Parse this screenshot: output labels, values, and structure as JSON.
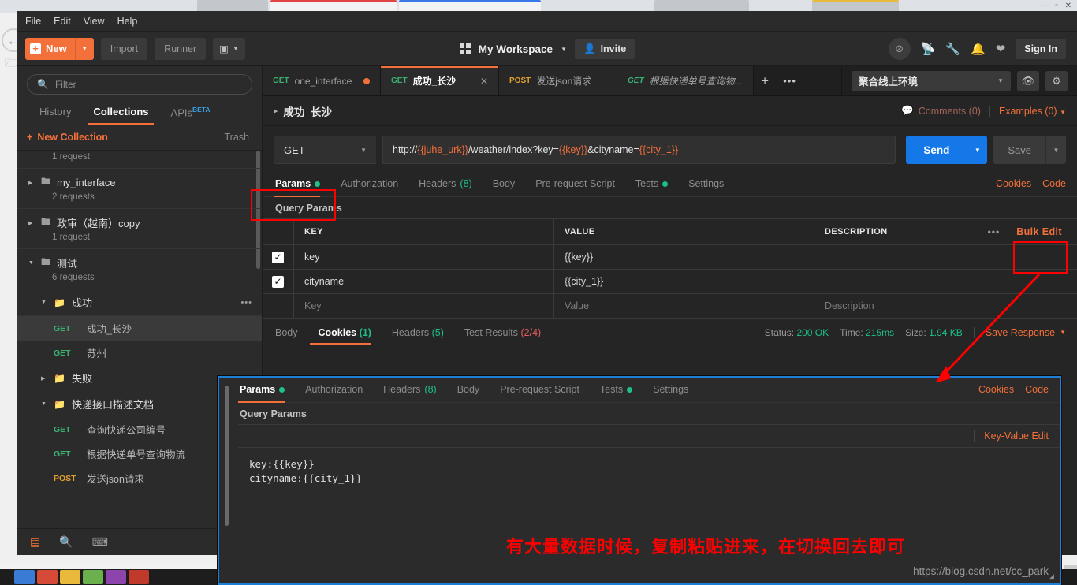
{
  "menubar": {
    "items": [
      "File",
      "Edit",
      "View",
      "Help"
    ]
  },
  "toolbar": {
    "new_label": "New",
    "import_label": "Import",
    "runner_label": "Runner",
    "workspace_name": "My Workspace",
    "invite_label": "Invite",
    "signin_label": "Sign In",
    "icons": [
      "eye-off-icon",
      "satellite-icon",
      "wrench-icon",
      "bell-icon",
      "heart-icon"
    ]
  },
  "sidebar": {
    "filter_placeholder": "Filter",
    "tabs": [
      {
        "label": "History",
        "active": false
      },
      {
        "label": "Collections",
        "active": true
      },
      {
        "label": "APIs",
        "badge": "BETA",
        "active": false
      }
    ],
    "new_collection_label": "New Collection",
    "trash_label": "Trash",
    "partial_top_request_count": "1 request",
    "collections": [
      {
        "name": "my_interface",
        "count": "2 requests",
        "expanded": false
      },
      {
        "name": "政审（越南）copy",
        "count": "1 request",
        "expanded": false
      },
      {
        "name": "测试",
        "count": "6 requests",
        "expanded": true
      }
    ],
    "folders": [
      {
        "name": "成功",
        "expanded": true,
        "requests": [
          {
            "method": "GET",
            "name": "成功_长沙",
            "selected": true
          },
          {
            "method": "GET",
            "name": "苏州",
            "selected": false
          }
        ]
      },
      {
        "name": "失败",
        "expanded": false,
        "requests": []
      },
      {
        "name": "快递接口描述文档",
        "expanded": true,
        "requests": [
          {
            "method": "GET",
            "name": "查询快递公司编号",
            "selected": false
          },
          {
            "method": "GET",
            "name": "根据快递单号查询物流",
            "selected": false
          },
          {
            "method": "POST",
            "name": "发送json请求",
            "selected": false
          }
        ]
      }
    ],
    "footer_icons": [
      "sidebar-toggle-icon",
      "search-icon",
      "console-icon"
    ]
  },
  "request_tabs": [
    {
      "method": "GET",
      "name": "one_interface",
      "state": "unsaved",
      "active": false,
      "italic": false
    },
    {
      "method": "GET",
      "name": "成功_长沙",
      "state": "close",
      "active": true,
      "italic": false
    },
    {
      "method": "POST",
      "name": "发送json请求",
      "state": "none",
      "active": false,
      "italic": false
    },
    {
      "method": "GET",
      "name": "根据快递单号查询物...",
      "state": "none",
      "active": false,
      "italic": true
    }
  ],
  "tabbar_actions": {
    "add": "+",
    "more": "•••"
  },
  "environment": {
    "selected": "聚合线上环境",
    "eye_icon": "eye-icon",
    "gear_icon": "gear-icon"
  },
  "request": {
    "title": "成功_长沙",
    "comments_label": "Comments (0)",
    "examples_label": "Examples (0)",
    "method": "GET",
    "url_prefix": "http://",
    "url_var1": "{{juhe_urk}}",
    "url_mid": "/weather/index?key=",
    "url_var2": "{{key}}",
    "url_mid2": "&cityname=",
    "url_var3": "{{city_1}}",
    "url_full": "http://{{juhe_urk}}/weather/index?key={{key}}&cityname={{city_1}}",
    "send_label": "Send",
    "save_label": "Save"
  },
  "req_tabs": [
    {
      "label": "Params",
      "dot": true,
      "active": true
    },
    {
      "label": "Authorization",
      "active": false
    },
    {
      "label": "Headers",
      "count": "(8)",
      "active": false
    },
    {
      "label": "Body",
      "active": false
    },
    {
      "label": "Pre-request Script",
      "active": false
    },
    {
      "label": "Tests",
      "dot": true,
      "active": false
    },
    {
      "label": "Settings",
      "active": false
    }
  ],
  "req_tabs_right": [
    "Cookies",
    "Code"
  ],
  "params": {
    "section_label": "Query Params",
    "headers": [
      "KEY",
      "VALUE",
      "DESCRIPTION"
    ],
    "bulk_edit_label": "Bulk Edit",
    "rows": [
      {
        "checked": true,
        "key": "key",
        "value": "{{key}}",
        "description": ""
      },
      {
        "checked": true,
        "key": "cityname",
        "value": "{{city_1}}",
        "description": ""
      }
    ],
    "placeholder_row": {
      "key": "Key",
      "value": "Value",
      "description": "Description"
    }
  },
  "response": {
    "tabs": [
      {
        "label": "Body",
        "active": false
      },
      {
        "label": "Cookies",
        "count": "(1)",
        "active": true
      },
      {
        "label": "Headers",
        "count": "(5)",
        "active": false
      },
      {
        "label": "Test Results",
        "count": "(2/4)",
        "active": false
      }
    ],
    "status_label": "Status:",
    "status_value": "200 OK",
    "time_label": "Time:",
    "time_value": "215ms",
    "size_label": "Size:",
    "size_value": "1.94 KB",
    "save_response_label": "Save Response"
  },
  "overlay": {
    "tabs": [
      {
        "label": "Params",
        "dot": true,
        "active": true
      },
      {
        "label": "Authorization",
        "active": false
      },
      {
        "label": "Headers",
        "count": "(8)",
        "active": false
      },
      {
        "label": "Body",
        "active": false
      },
      {
        "label": "Pre-request Script",
        "active": false
      },
      {
        "label": "Tests",
        "dot": true,
        "active": false
      },
      {
        "label": "Settings",
        "active": false
      }
    ],
    "tabs_right": [
      "Cookies",
      "Code"
    ],
    "section_label": "Query Params",
    "key_value_edit_label": "Key-Value Edit",
    "bulk_text": "key:{{key}}\ncityname:{{city_1}}",
    "annotation": "有大量数据时候，复制粘贴进来，在切换回去即可"
  },
  "watermark": "https://blog.csdn.net/cc_park",
  "colors": {
    "accent": "#f3703a",
    "send": "#1478e8",
    "success_green": "#1ec08a",
    "get_green": "#3bb273",
    "post_orange": "#e0a030",
    "annotation_red": "#ff0000",
    "overlay_border": "#1d7fd6"
  }
}
